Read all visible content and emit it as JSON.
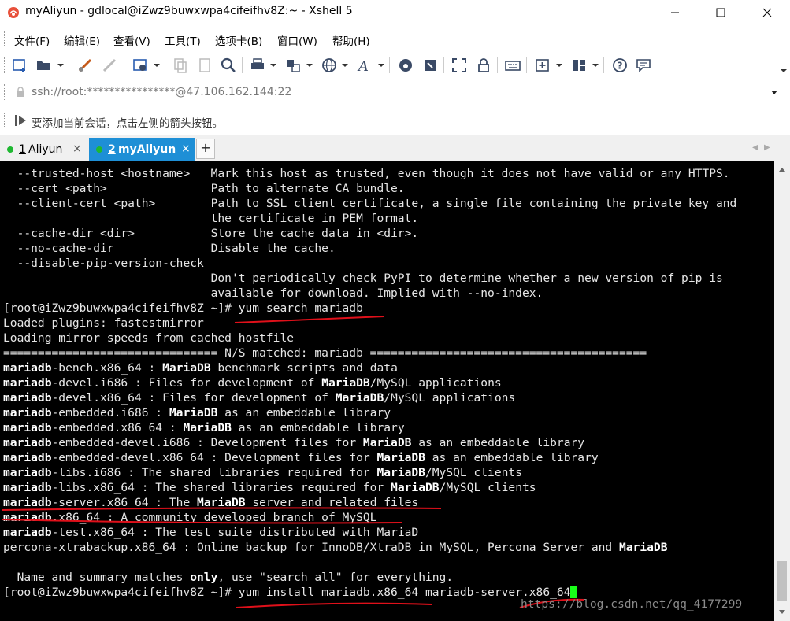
{
  "window": {
    "title": "myAliyun - gdlocal@iZwz9buwxwpa4cifeifhv8Z:~ - Xshell 5",
    "minimize_glyph": "—",
    "maximize_glyph": "☐",
    "close_glyph": "✕"
  },
  "menu": [
    "文件(F)",
    "编辑(E)",
    "查看(V)",
    "工具(T)",
    "选项卡(B)",
    "窗口(W)",
    "帮助(H)"
  ],
  "address": {
    "value": "ssh://root:****************@47.106.162.144:22"
  },
  "hint": {
    "text": "要添加当前会话，点击左侧的箭头按钮。"
  },
  "tabs": [
    {
      "number": "1",
      "name": "Aliyun",
      "close": "×",
      "active": false
    },
    {
      "number": "2",
      "name": "myAliyun",
      "close": "×",
      "active": true
    }
  ],
  "tab_add_label": "+",
  "tab_nav": {
    "prev": "◀",
    "next": "▶"
  },
  "terminal": {
    "lines": [
      "  --trusted-host <hostname>   Mark this host as trusted, even though it does not have valid or any HTTPS.",
      "  --cert <path>               Path to alternate CA bundle.",
      "  --client-cert <path>        Path to SSL client certificate, a single file containing the private key and",
      "                              the certificate in PEM format.",
      "  --cache-dir <dir>           Store the cache data in <dir>.",
      "  --no-cache-dir              Disable the cache.",
      "  --disable-pip-version-check",
      "                              Don't periodically check PyPI to determine whether a new version of pip is",
      "                              available for download. Implied with --no-index.",
      "[root@iZwz9buwxwpa4cifeifhv8Z ~]# yum search mariadb",
      "Loaded plugins: fastestmirror",
      "Loading mirror speeds from cached hostfile",
      "=============================== N/S matched: mariadb ========================================",
      "**mariadb**-bench.x86_64 : **MariaDB** benchmark scripts and data",
      "**mariadb**-devel.i686 : Files for development of **MariaDB**/MySQL applications",
      "**mariadb**-devel.x86_64 : Files for development of **MariaDB**/MySQL applications",
      "**mariadb**-embedded.i686 : **MariaDB** as an embeddable library",
      "**mariadb**-embedded.x86_64 : **MariaDB** as an embeddable library",
      "**mariadb**-embedded-devel.i686 : Development files for **MariaDB** as an embeddable library",
      "**mariadb**-embedded-devel.x86_64 : Development files for **MariaDB** as an embeddable library",
      "**mariadb**-libs.i686 : The shared libraries required for **MariaDB**/MySQL clients",
      "**mariadb**-libs.x86_64 : The shared libraries required for **MariaDB**/MySQL clients",
      "**mariadb**-server.x86_64 : The **MariaDB** server and related files",
      "**mariadb**.x86_64 : A community developed branch of MySQL",
      "**mariadb**-test.x86_64 : The test suite distributed with MariaD",
      "percona-xtrabackup.x86_64 : Online backup for InnoDB/XtraDB in MySQL, Percona Server and **MariaDB**",
      "",
      "  Name and summary matches **only**, use \"search all\" for everything.",
      "[root@iZwz9buwxwpa4cifeifhv8Z ~]# yum install mariadb.x86_64 mariadb-server.x86_64"
    ]
  },
  "watermark": "https://blog.csdn.net/qq_4177299",
  "colors": {
    "terminal_bg": "#000000",
    "terminal_fg": "#e6e6e6",
    "cursor": "#19ff19",
    "annotation": "#e0101a",
    "active_tab": "#1e8fd6",
    "status_dot": "#1fb832"
  }
}
